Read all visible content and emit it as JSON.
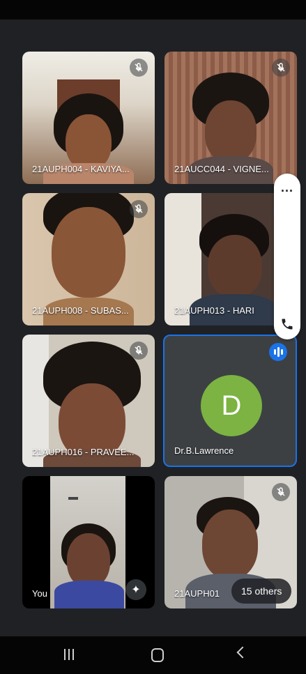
{
  "participants": [
    {
      "name": "21AUPH004 - KAVIYA...",
      "muted": true
    },
    {
      "name": "21AUCC044 - VIGNE...",
      "muted": true
    },
    {
      "name": "21AUPH008 - SUBAS...",
      "muted": true
    },
    {
      "name": "21AUPH013 - HARI",
      "muted": true
    },
    {
      "name": "21AUPH016 - PRAVEE...",
      "muted": true
    },
    {
      "name": "Dr.B.Lawrence",
      "initial": "D",
      "speaking": true
    },
    {
      "name": "You"
    },
    {
      "name": "21AUPH01",
      "muted": true
    }
  ],
  "overflow": {
    "label": "15 others"
  },
  "side_panel": {
    "more": "...",
    "call_icon": "phone-icon"
  },
  "colors": {
    "background": "#202124",
    "avatar": "#7cb342",
    "accent": "#1a73e8"
  }
}
